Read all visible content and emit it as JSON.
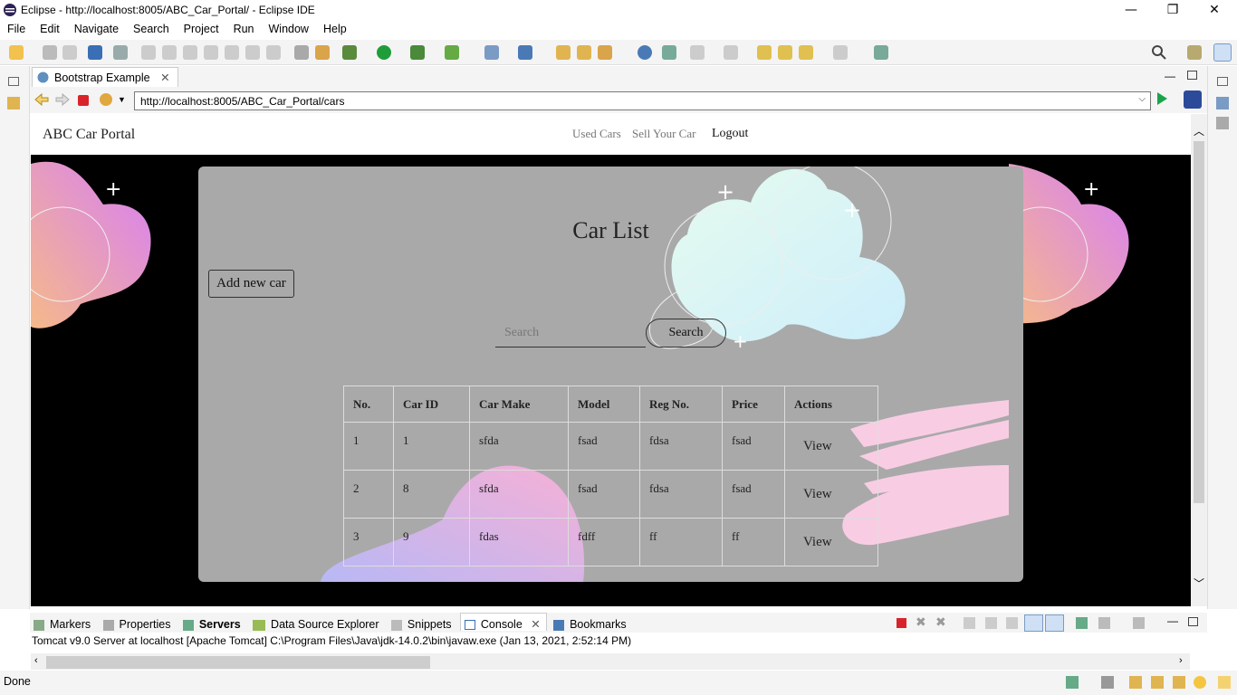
{
  "window": {
    "title": "Eclipse - http://localhost:8005/ABC_Car_Portal/ - Eclipse IDE",
    "minimize_icon": "minimize-icon",
    "restore_icon": "restore-icon",
    "close_icon": "close-icon"
  },
  "menu": [
    "File",
    "Edit",
    "Navigate",
    "Search",
    "Project",
    "Run",
    "Window",
    "Help"
  ],
  "editor_tab": {
    "label": "Bootstrap Example"
  },
  "browser": {
    "url": "http://localhost:8005/ABC_Car_Portal/cars"
  },
  "page": {
    "brand": "ABC Car Portal",
    "nav": {
      "used_cars": "Used Cars",
      "sell_car": "Sell Your Car",
      "logout": "Logout"
    },
    "title": "Car List",
    "add_button": "Add new car",
    "search_placeholder": "Search",
    "search_button": "Search",
    "table": {
      "headers": [
        "No.",
        "Car ID",
        "Car Make",
        "Model",
        "Reg No.",
        "Price",
        "Actions"
      ],
      "rows": [
        [
          "1",
          "1",
          "sfda",
          "fsad",
          "fdsa",
          "fsad",
          "View"
        ],
        [
          "2",
          "8",
          "sfda",
          "fsad",
          "fdsa",
          "fsad",
          "View"
        ],
        [
          "3",
          "9",
          "fdas",
          "fdff",
          "ff",
          "ff",
          "View"
        ]
      ]
    }
  },
  "bottom_tabs": [
    "Markers",
    "Properties",
    "Servers",
    "Data Source Explorer",
    "Snippets",
    "Console",
    "Bookmarks"
  ],
  "console_line": "Tomcat v9.0 Server at localhost [Apache Tomcat] C:\\Program Files\\Java\\jdk-14.0.2\\bin\\javaw.exe  (Jan 13, 2021, 2:52:14 PM)",
  "status": "Done",
  "colors": {
    "card_bg": "#a9a9a9",
    "page_bg": "#000000",
    "blob_pink": "#e07ee8",
    "blob_cyan": "#d6f5f8"
  }
}
